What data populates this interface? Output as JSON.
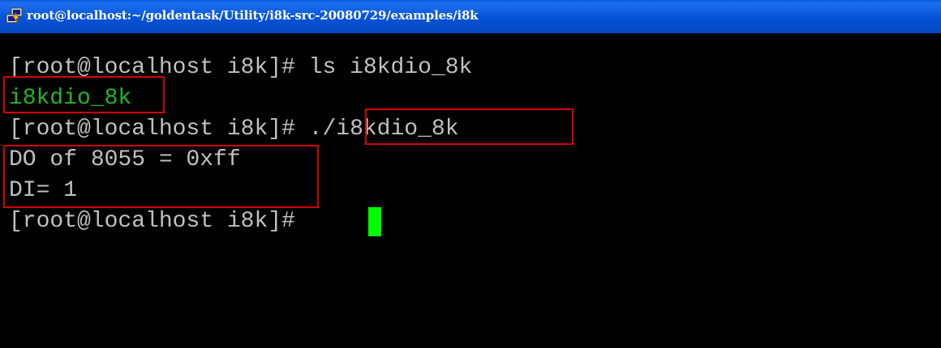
{
  "window": {
    "title": "root@localhost:~/goldentask/Utility/i8k-src-20080729/examples/i8k",
    "icon": "putty-terminal-icon"
  },
  "terminal": {
    "lines": [
      {
        "text": "[root@localhost i8k]# ls i8kdio_8k",
        "color": "#c0c0c0"
      },
      {
        "text": "i8kdio_8k",
        "color": "#26b426"
      },
      {
        "text": "[root@localhost i8k]# ./i8kdio_8k",
        "color": "#c0c0c0"
      },
      {
        "text": "DO of 8055 = 0xff",
        "color": "#c0c0c0"
      },
      {
        "text": "DI= 1",
        "color": "#c0c0c0"
      },
      {
        "text": "[root@localhost i8k]# ",
        "color": "#c0c0c0"
      }
    ],
    "background": "#000000",
    "cursor_color": "#00ff00",
    "highlight_color": "#d50000"
  }
}
